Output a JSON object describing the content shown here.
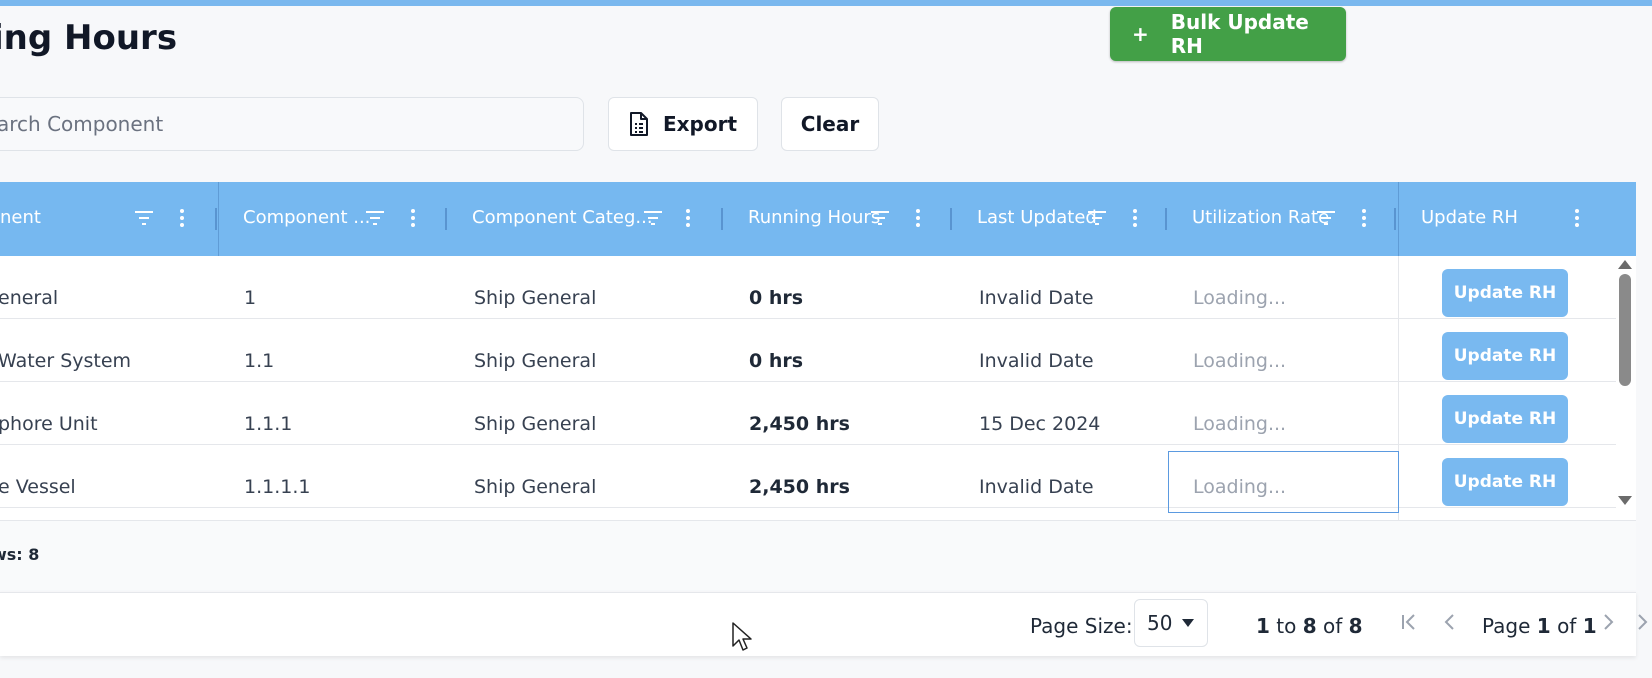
{
  "title": "ing Hours",
  "bulk_button": {
    "plus": "+",
    "label": "Bulk Update RH"
  },
  "search": {
    "placeholder": "arch Component"
  },
  "export_label": "Export",
  "clear_label": "Clear",
  "columns": [
    "nent",
    "Component ...",
    "Component Categ...",
    "Running Hours",
    "Last Updated",
    "Utilization Rate",
    "Update RH"
  ],
  "rows": [
    {
      "name": "eneral",
      "code": "1",
      "category": "Ship General",
      "hours": "0 hrs",
      "updated": "Invalid Date",
      "rate": "Loading...",
      "action": "Update RH"
    },
    {
      "name": "Water System",
      "code": "1.1",
      "category": "Ship General",
      "hours": "0 hrs",
      "updated": "Invalid Date",
      "rate": "Loading...",
      "action": "Update RH"
    },
    {
      "name": "phore Unit",
      "code": "1.1.1",
      "category": "Ship General",
      "hours": "2,450 hrs",
      "updated": "15 Dec 2024",
      "rate": "Loading...",
      "action": "Update RH"
    },
    {
      "name": "e Vessel",
      "code": "1.1.1.1",
      "category": "Ship General",
      "hours": "2,450 hrs",
      "updated": "Invalid Date",
      "rate": "Loading...",
      "action": "Update RH"
    }
  ],
  "status": {
    "rows_text": "ws: 8"
  },
  "pager": {
    "page_size_label": "Page Size:",
    "page_size_value": "50",
    "range_start": "1",
    "range_to": "to",
    "range_end": "8",
    "range_of": "of",
    "range_total": "8",
    "page_label": "Page",
    "page_current": "1",
    "page_of": "of",
    "page_total": "1"
  }
}
